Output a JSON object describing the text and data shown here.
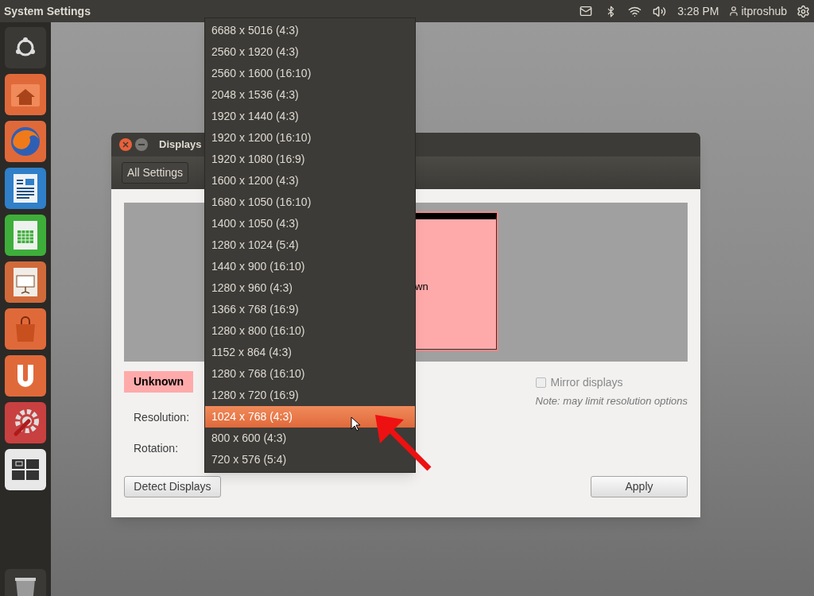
{
  "top_bar": {
    "app_title": "System Settings",
    "clock": "3:28 PM",
    "user": "itproshub"
  },
  "window": {
    "title": "Displays",
    "toolbar_button": "All Settings",
    "monitor_label": "wn",
    "display_badge": "Unknown",
    "mirror": {
      "label": "Mirror displays",
      "checked": false,
      "disabled": true
    },
    "note": "Note: may limit resolution options",
    "fields": [
      {
        "label": "Resolution:"
      },
      {
        "label": "Rotation:"
      }
    ],
    "buttons": [
      {
        "label": "Detect Displays"
      },
      {
        "label": "Apply"
      }
    ]
  },
  "resolution_menu": {
    "items": [
      {
        "label": "6688 x 5016 (4:3)",
        "selected": false
      },
      {
        "label": "2560 x 1920 (4:3)",
        "selected": false
      },
      {
        "label": "2560 x 1600 (16:10)",
        "selected": false
      },
      {
        "label": "2048 x 1536 (4:3)",
        "selected": false
      },
      {
        "label": "1920 x 1440 (4:3)",
        "selected": false
      },
      {
        "label": "1920 x 1200 (16:10)",
        "selected": false
      },
      {
        "label": "1920 x 1080 (16:9)",
        "selected": false
      },
      {
        "label": "1600 x 1200 (4:3)",
        "selected": false
      },
      {
        "label": "1680 x 1050 (16:10)",
        "selected": false
      },
      {
        "label": "1400 x 1050 (4:3)",
        "selected": false
      },
      {
        "label": "1280 x 1024 (5:4)",
        "selected": false
      },
      {
        "label": "1440 x 900 (16:10)",
        "selected": false
      },
      {
        "label": "1280 x 960 (4:3)",
        "selected": false
      },
      {
        "label": "1366 x 768 (16:9)",
        "selected": false
      },
      {
        "label": "1280 x 800 (16:10)",
        "selected": false
      },
      {
        "label": "1152 x 864 (4:3)",
        "selected": false
      },
      {
        "label": "1280 x 768 (16:10)",
        "selected": false
      },
      {
        "label": "1280 x 720 (16:9)",
        "selected": false
      },
      {
        "label": "1024 x 768 (4:3)",
        "selected": true
      },
      {
        "label": "800 x 600 (4:3)",
        "selected": false
      },
      {
        "label": "720 x 576 (5:4)",
        "selected": false
      }
    ]
  }
}
